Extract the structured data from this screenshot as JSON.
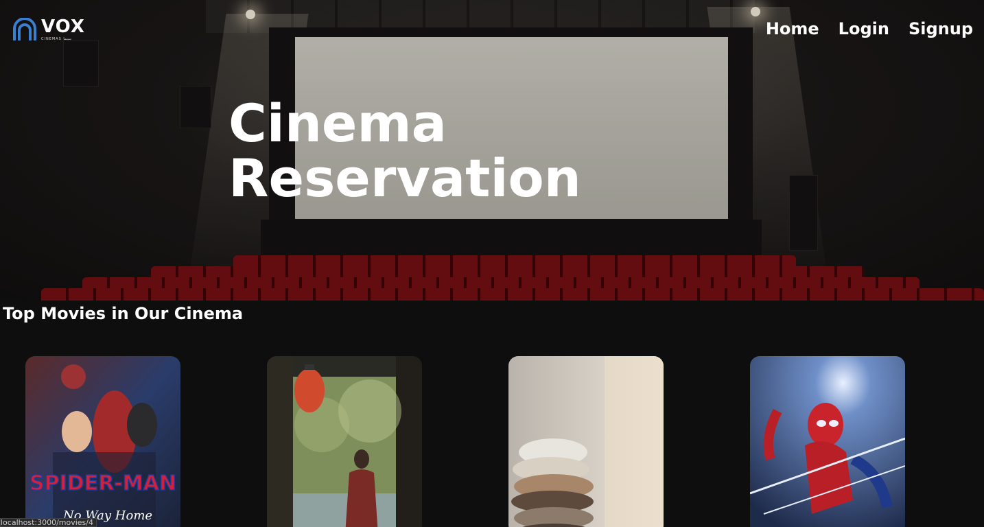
{
  "brand": {
    "name": "VOX",
    "tagline": "CINEMAS سينما"
  },
  "nav": {
    "home": "Home",
    "login": "Login",
    "signup": "Signup"
  },
  "hero": {
    "title_line1": "Cinema",
    "title_line2": "Reservation"
  },
  "section": {
    "title": "Top Movies in Our Cinema"
  },
  "movies": [
    {
      "poster_title": "SPIDER-MAN",
      "poster_subtitle": "No Way Home"
    },
    {
      "poster_title": ""
    },
    {
      "poster_title": ""
    },
    {
      "poster_title": ""
    }
  ],
  "status_bar": {
    "url": "localhost:3000/movies/4"
  },
  "colors": {
    "background": "#0e0e0e",
    "seat_red": "#7a1014",
    "logo_blue": "#3b7fd0"
  }
}
